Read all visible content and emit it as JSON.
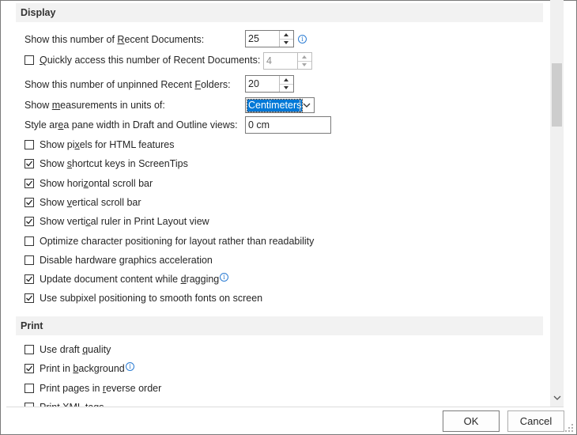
{
  "display": {
    "title": "Display",
    "recent_docs": {
      "pre": "Show this number of ",
      "u": "R",
      "post": "ecent Documents:",
      "value": "25"
    },
    "quick_access": {
      "u": "Q",
      "post": "uickly access this number of Recent Documents:",
      "value": "4",
      "checked": false
    },
    "recent_folders": {
      "pre": "Show this number of unpinned Recent ",
      "u": "F",
      "post": "olders:",
      "value": "20"
    },
    "units": {
      "pre": "Show ",
      "u": "m",
      "post": "easurements in units of:",
      "value": "Centimeters"
    },
    "style_area": {
      "pre": "Style ar",
      "u": "e",
      "post": "a pane width in Draft and Outline views:",
      "value": "0 cm"
    },
    "checkboxes": [
      {
        "pre": "Show pi",
        "u": "x",
        "post": "els for HTML features",
        "checked": false
      },
      {
        "pre": "Show ",
        "u": "s",
        "post": "hortcut keys in ScreenTips",
        "checked": true
      },
      {
        "pre": "Show hori",
        "u": "z",
        "post": "ontal scroll bar",
        "checked": true
      },
      {
        "pre": "Show ",
        "u": "v",
        "post": "ertical scroll bar",
        "checked": true
      },
      {
        "pre": "Show verti",
        "u": "c",
        "post": "al ruler in Print Layout view",
        "checked": true
      },
      {
        "pre": "Optimize character positioning for layout rather than readability",
        "u": "",
        "post": "",
        "checked": false
      },
      {
        "pre": "Disable hardware ",
        "u": "g",
        "post": "raphics acceleration",
        "checked": false
      },
      {
        "pre": "Update document content while ",
        "u": "d",
        "post": "ragging",
        "checked": true
      },
      {
        "pre": "Use subpixel positioning to smooth fonts on screen",
        "u": "",
        "post": "",
        "checked": true
      }
    ]
  },
  "print": {
    "title": "Print",
    "checkboxes": [
      {
        "pre": "Use draft ",
        "u": "q",
        "post": "uality",
        "checked": false
      },
      {
        "pre": "Print in ",
        "u": "b",
        "post": "ackground",
        "checked": true
      },
      {
        "pre": "Print pages in ",
        "u": "r",
        "post": "everse order",
        "checked": false
      },
      {
        "pre": "Print XML tags",
        "u": "",
        "post": "",
        "checked": false
      }
    ]
  },
  "icons": {
    "info": "i"
  },
  "buttons": {
    "ok": "OK",
    "cancel": "Cancel"
  }
}
